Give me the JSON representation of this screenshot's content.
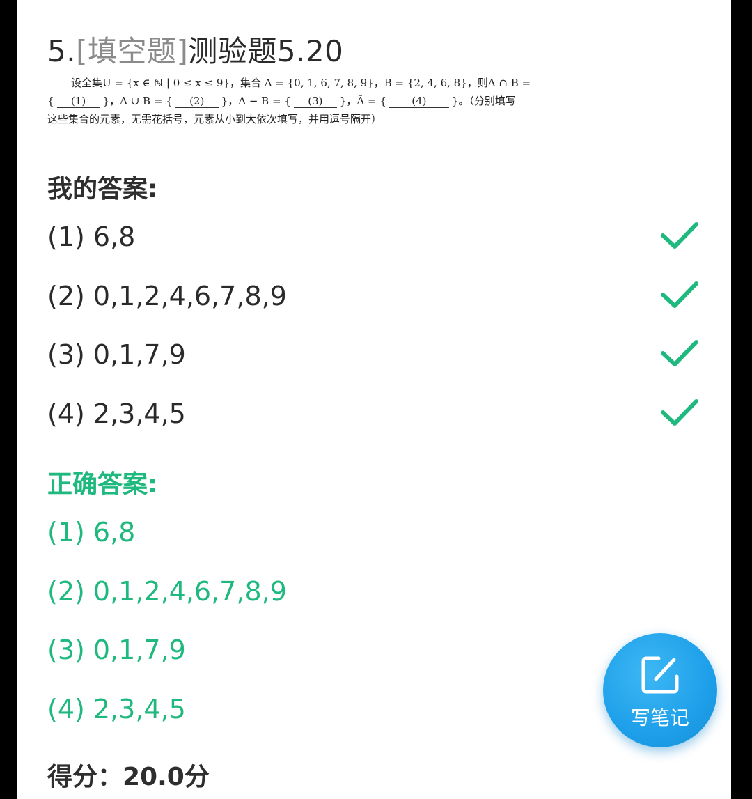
{
  "question": {
    "number": "5.",
    "type": "[填空题]",
    "title": "测验题5.20",
    "line1_a": "设全集",
    "line1_b": "U = {x ∈ ℕ | 0 ≤ x ≤ 9}，集合",
    "line1_c": "A = {0, 1, 6, 7, 8, 9}，B = {2, 4, 6, 8}，则",
    "line1_d": "A ∩ B =",
    "line2_open": "{",
    "blank1": "(1)",
    "line2_b": "}，A ∪ B = {",
    "blank2": "(2)",
    "line2_c": "}，A − B = {",
    "blank3": "(3)",
    "line2_d": "}，Ā = {",
    "blank4": "(4)",
    "line2_e": "}。（分别填写",
    "line3": "这些集合的元素，无需花括号，元素从小到大依次填写，并用逗号隔开）"
  },
  "my_answer": {
    "heading": "我的答案:",
    "items": [
      {
        "text": "(1) 6,8",
        "status": "correct"
      },
      {
        "text": "(2) 0,1,2,4,6,7,8,9",
        "status": "correct"
      },
      {
        "text": "(3) 0,1,7,9",
        "status": "correct"
      },
      {
        "text": "(4) 2,3,4,5",
        "status": "correct"
      }
    ]
  },
  "correct_answer": {
    "heading": "正确答案:",
    "items": [
      {
        "text": "(1) 6,8"
      },
      {
        "text": "(2) 0,1,2,4,6,7,8,9"
      },
      {
        "text": "(3) 0,1,7,9"
      },
      {
        "text": "(4) 2,3,4,5"
      }
    ]
  },
  "score": {
    "text": "得分：20.0分"
  },
  "fab": {
    "label": "写笔记",
    "icon": "edit-note-icon"
  },
  "colors": {
    "accent_green": "#1fb97f",
    "fab_blue": "#1e9fe9",
    "check_green": "#1fb97f"
  }
}
